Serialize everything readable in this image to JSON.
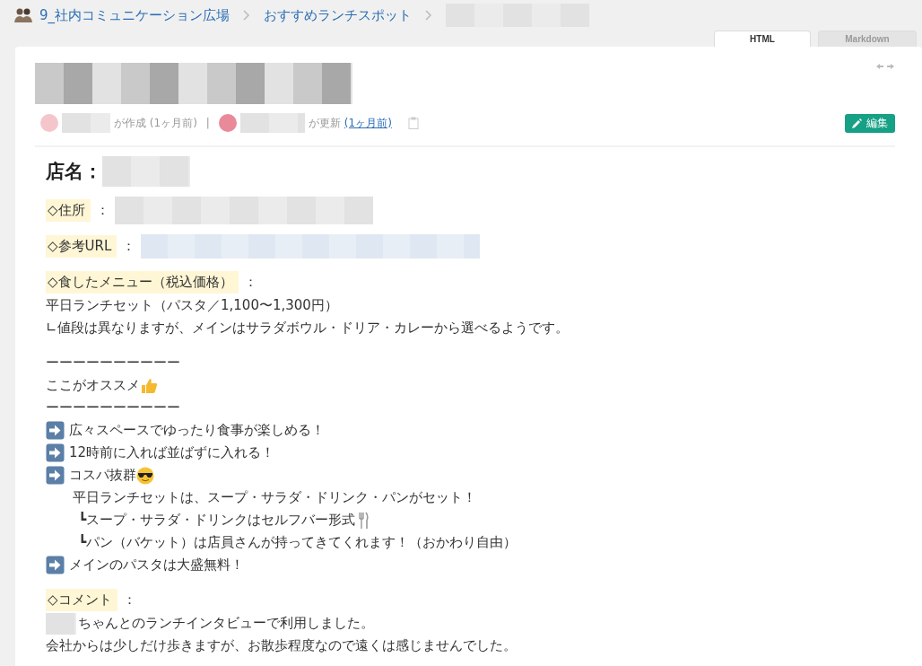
{
  "breadcrumb": [
    {
      "text": "9_社内コミュニケーション広場",
      "kind": "group"
    },
    {
      "text": "おすすめランチスポット",
      "kind": "folder"
    },
    {
      "kind": "redacted"
    }
  ],
  "tabs": [
    {
      "label": "HTML",
      "selected": true
    },
    {
      "label": "Markdown",
      "selected": false
    }
  ],
  "meta": {
    "created": "が作成 (1ヶ月前)",
    "separator": "|",
    "updated": "が更新",
    "updated_time": "(1ヶ月前)"
  },
  "edit_button": "編集",
  "blocks": [
    {
      "kind": "heading",
      "text": "店名："
    },
    {
      "kind": "address",
      "label": "◇住所",
      "sep": "："
    },
    {
      "kind": "url",
      "label": "◇参考URL",
      "sep": "："
    },
    {
      "kind": "field",
      "label": "◇食したメニュー（税込価格）",
      "sep": "："
    },
    {
      "kind": "text",
      "text": "平日ランチセット（パスタ／1,100〜1,300円）"
    },
    {
      "kind": "text",
      "text": "∟値段は異なりますが、メインはサラダボウル・ドリア・カレーから選べるようです。"
    },
    {
      "kind": "break"
    },
    {
      "kind": "text",
      "text": "ーーーーーーーーーー"
    },
    {
      "kind": "recommend",
      "text": "ここがオススメ"
    },
    {
      "kind": "text",
      "text": "ーーーーーーーーーー"
    },
    {
      "kind": "bullet",
      "text": "広々スペースでゆったり食事が楽しめる！"
    },
    {
      "kind": "bullet",
      "text": "12時前に入れば並ばずに入れる！"
    },
    {
      "kind": "cool",
      "text": "コスパ抜群",
      "children": [
        {
          "kind": "line",
          "text": "平日ランチセットは、スープ・サラダ・ドリンク・パンがセット！",
          "children": [
            {
              "kind": "selfbar",
              "text": "┗スープ・サラダ・ドリンクはセルフバー形式"
            },
            {
              "kind": "line",
              "text": "┗パン（バケット）は店員さんが持ってきてくれます！（おかわり自由）"
            }
          ]
        }
      ]
    },
    {
      "kind": "bullet",
      "text": "メインのパスタは大盛無料！"
    },
    {
      "kind": "field",
      "label": "◇コメント",
      "sep": "："
    },
    {
      "kind": "mention",
      "text": "ちゃんとのランチインタビューで利用しました。"
    },
    {
      "kind": "text",
      "text": "会社からは少しだけ歩きますが、お散歩程度なので遠くは感じませんでした。"
    }
  ]
}
